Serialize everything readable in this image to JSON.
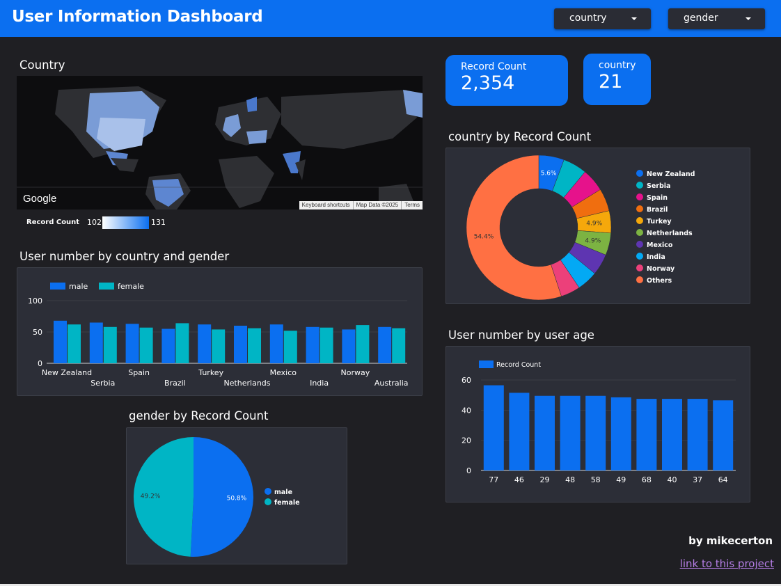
{
  "header": {
    "title": "User Information Dashboard"
  },
  "filters": {
    "country_label": "country",
    "gender_label": "gender"
  },
  "map_section": {
    "title": "Country",
    "google_label": "Google",
    "attribution": [
      "Keyboard shortcuts",
      "Map Data ©2025",
      "Terms"
    ],
    "legend_label": "Record Count",
    "legend_min": "102",
    "legend_max": "131"
  },
  "kpis": {
    "record_count_label": "Record Count",
    "record_count_value": "2,354",
    "country_label": "country",
    "country_value": "21"
  },
  "colors": {
    "accent": "#0b6ff0",
    "male": "#0b6ff0",
    "female": "#00b5c5",
    "link": "#b57ee6"
  },
  "bar_section": {
    "title": "User number by country and gender"
  },
  "donut_section": {
    "title": "country by Record Count"
  },
  "age_section": {
    "title": "User number by user age"
  },
  "pie_section": {
    "title": "gender by Record Count"
  },
  "footer": {
    "by": "by mikecerton",
    "link": "link to this project"
  },
  "chart_data": [
    {
      "type": "bar",
      "categories": [
        "New Zealand",
        "Serbia",
        "Spain",
        "Brazil",
        "Turkey",
        "Netherlands",
        "Mexico",
        "India",
        "Norway",
        "Australia"
      ],
      "series": [
        {
          "name": "male",
          "values": [
            68,
            65,
            63,
            55,
            62,
            60,
            62,
            58,
            54,
            58
          ]
        },
        {
          "name": "female",
          "values": [
            62,
            58,
            57,
            64,
            54,
            56,
            52,
            57,
            61,
            56
          ]
        }
      ],
      "yticks": [
        0,
        50,
        100
      ],
      "ylim": [
        0,
        100
      ],
      "legend": "top-left"
    },
    {
      "type": "pie",
      "donut": true,
      "labels": [
        "New Zealand",
        "Serbia",
        "Spain",
        "Brazil",
        "Turkey",
        "Netherlands",
        "Mexico",
        "India",
        "Norway",
        "Others"
      ],
      "values": [
        5.6,
        5.3,
        5.1,
        5.0,
        4.9,
        4.9,
        4.7,
        4.6,
        4.3,
        54.4
      ],
      "colors": [
        "#0b6ff0",
        "#00b5c5",
        "#e6128b",
        "#f06e0f",
        "#f5a80b",
        "#7cb342",
        "#5e35b1",
        "#03a9f4",
        "#ec407a",
        "#ff7043"
      ],
      "data_labels": [
        {
          "index": 0,
          "text": "5.6%"
        },
        {
          "index": 4,
          "text": "4.9%"
        },
        {
          "index": 5,
          "text": "4.9%"
        },
        {
          "index": 9,
          "text": "54.4%"
        }
      ],
      "legend": "right"
    },
    {
      "type": "bar",
      "categories": [
        "77",
        "46",
        "29",
        "48",
        "58",
        "49",
        "68",
        "40",
        "37",
        "64"
      ],
      "series": [
        {
          "name": "Record Count",
          "values": [
            56.5,
            51.5,
            49.5,
            49.5,
            49.5,
            48.5,
            47.5,
            47.5,
            47.5,
            46.5
          ]
        }
      ],
      "yticks": [
        0,
        20,
        40,
        60
      ],
      "ylim": [
        0,
        60
      ],
      "legend": "top-left"
    },
    {
      "type": "pie",
      "labels": [
        "male",
        "female"
      ],
      "values": [
        50.8,
        49.2
      ],
      "colors": [
        "#0b6ff0",
        "#00b5c5"
      ],
      "data_labels": [
        "50.8%",
        "49.2%"
      ],
      "legend": "right"
    }
  ]
}
